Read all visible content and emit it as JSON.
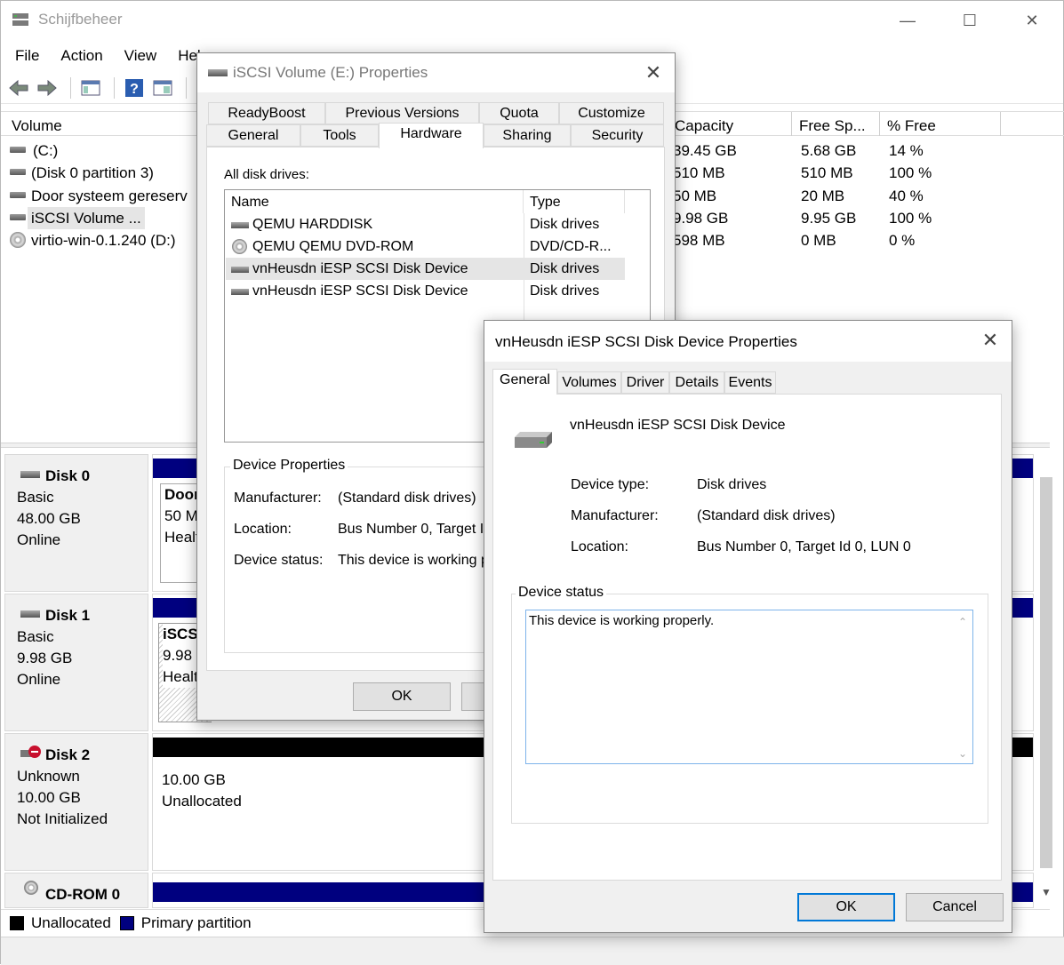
{
  "app": {
    "title": "Schijfbeheer",
    "controls": {
      "minimize": "—",
      "maximize": "☐",
      "close": "✕"
    }
  },
  "menu": [
    "File",
    "Action",
    "View",
    "Help"
  ],
  "toolbar_icons": [
    "back-arrow-icon",
    "forward-arrow-icon",
    "console-tree-icon",
    "help-icon",
    "properties-icon",
    "more-icon"
  ],
  "volume_table": {
    "columns": [
      "Volume",
      "Capacity",
      "Free Sp...",
      "% Free"
    ],
    "rows": [
      {
        "volume": "(C:)",
        "capacity": "39.45 GB",
        "free": "5.68 GB",
        "pct": "14 %",
        "icon": "drive-icon"
      },
      {
        "volume": "(Disk 0 partition 3)",
        "capacity": "510 MB",
        "free": "510 MB",
        "pct": "100 %",
        "icon": "drive-icon"
      },
      {
        "volume": "Door systeem gereserv",
        "capacity": "50 MB",
        "free": "20 MB",
        "pct": "40 %",
        "icon": "drive-icon"
      },
      {
        "volume": "iSCSI Volume ...",
        "capacity": "9.98 GB",
        "free": "9.95 GB",
        "pct": "100 %",
        "icon": "drive-icon"
      },
      {
        "volume": "virtio-win-0.1.240 (D:)",
        "capacity": "598 MB",
        "free": "0 MB",
        "pct": "0 %",
        "icon": "cd-icon"
      }
    ]
  },
  "disks": [
    {
      "name": "Disk 0",
      "type": "Basic",
      "size": "48.00 GB",
      "status": "Online",
      "part_title": "Door",
      "part_size": "50 M",
      "part_status": "Healt"
    },
    {
      "name": "Disk 1",
      "type": "Basic",
      "size": "9.98 GB",
      "status": "Online",
      "part_title": "iSCSI",
      "part_size": "9.98",
      "part_status": "Healt"
    },
    {
      "name": "Disk 2",
      "type": "Unknown",
      "size": "10.00 GB",
      "status": "Not Initialized",
      "part_size": "10.00 GB",
      "part_status": "Unallocated"
    },
    {
      "name": "CD-ROM 0"
    }
  ],
  "legend": {
    "unallocated": "Unallocated",
    "primary": "Primary partition",
    "unallocated_color": "#000000",
    "primary_color": "#00007f"
  },
  "dialog1": {
    "title": "iSCSI Volume (E:) Properties",
    "tabs_row1": [
      "ReadyBoost",
      "Previous Versions",
      "Quota",
      "Customize"
    ],
    "tabs_row2": [
      "General",
      "Tools",
      "Hardware",
      "Sharing",
      "Security"
    ],
    "all_drives_label": "All disk drives:",
    "list_headers": [
      "Name",
      "Type"
    ],
    "drives": [
      {
        "name": "QEMU HARDDISK",
        "type": "Disk drives"
      },
      {
        "name": "QEMU QEMU DVD-ROM",
        "type": "DVD/CD-R..."
      },
      {
        "name": "vnHeusdn iESP SCSI Disk Device",
        "type": "Disk drives"
      },
      {
        "name": "vnHeusdn iESP SCSI Disk Device",
        "type": "Disk drives"
      }
    ],
    "device_props_label": "Device Properties",
    "manufacturer_label": "Manufacturer:",
    "manufacturer_value": "(Standard disk drives)",
    "location_label": "Location:",
    "location_value": "Bus Number 0, Target Id",
    "status_label": "Device status:",
    "status_value": "This device is working pr",
    "ok": "OK"
  },
  "dialog2": {
    "title": "vnHeusdn iESP SCSI Disk Device Properties",
    "tabs": [
      "General",
      "Volumes",
      "Driver",
      "Details",
      "Events"
    ],
    "device_name": "vnHeusdn iESP SCSI Disk Device",
    "device_type_label": "Device type:",
    "device_type_value": "Disk drives",
    "manufacturer_label": "Manufacturer:",
    "manufacturer_value": "(Standard disk drives)",
    "location_label": "Location:",
    "location_value": "Bus Number 0, Target Id 0, LUN 0",
    "status_group": "Device status",
    "status_text": "This device is working properly.",
    "ok": "OK",
    "cancel": "Cancel"
  }
}
